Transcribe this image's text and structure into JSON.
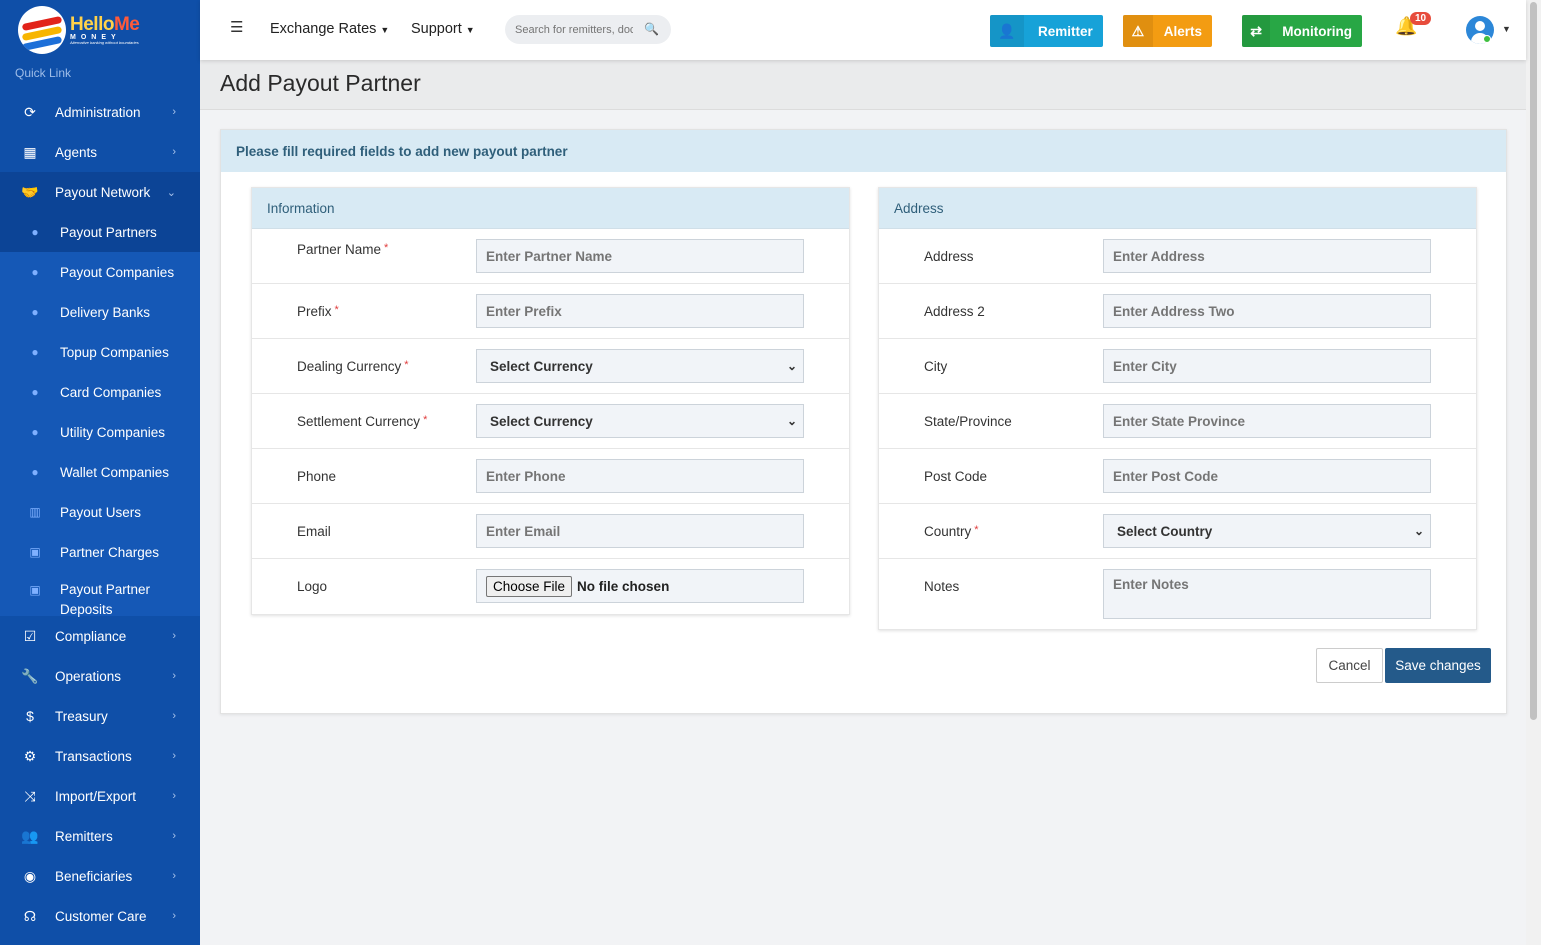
{
  "logo": {
    "brand_a": "Hello",
    "brand_b": "Me",
    "sub": "MONEY",
    "tagline": "Alternative banking without boundaries"
  },
  "sidebar": {
    "quick_link": "Quick Link",
    "items_before": [
      {
        "label": "Administration",
        "icon": "refresh-icon"
      },
      {
        "label": "Agents",
        "icon": "building-icon"
      }
    ],
    "open_item": {
      "label": "Payout Network",
      "icon": "handshake-icon"
    },
    "sub_items": [
      {
        "label": "Payout Partners",
        "icon": "user-icon"
      },
      {
        "label": "Payout Companies",
        "icon": "user-icon"
      },
      {
        "label": "Delivery Banks",
        "icon": "user-icon"
      },
      {
        "label": "Topup Companies",
        "icon": "user-icon"
      },
      {
        "label": "Card Companies",
        "icon": "user-icon"
      },
      {
        "label": "Utility Companies",
        "icon": "user-icon"
      },
      {
        "label": "Wallet Companies",
        "icon": "user-icon"
      },
      {
        "label": "Payout Users",
        "icon": "bank-icon"
      },
      {
        "label": "Partner Charges",
        "icon": "money-icon"
      },
      {
        "label": "Payout Partner Deposits",
        "icon": "money-icon"
      }
    ],
    "items_after": [
      {
        "label": "Compliance",
        "icon": "check-square-icon"
      },
      {
        "label": "Operations",
        "icon": "wrench-icon"
      },
      {
        "label": "Treasury",
        "icon": "dollar-icon"
      },
      {
        "label": "Transactions",
        "icon": "cogs-icon"
      },
      {
        "label": "Import/Export",
        "icon": "shuffle-icon"
      },
      {
        "label": "Remitters",
        "icon": "users-icon"
      },
      {
        "label": "Beneficiaries",
        "icon": "user-circle-icon"
      },
      {
        "label": "Customer Care",
        "icon": "headset-icon"
      }
    ]
  },
  "topbar": {
    "exchange_rates": "Exchange Rates",
    "support": "Support",
    "search_placeholder": "Search for remitters, docs...",
    "remitter": "Remitter",
    "alerts": "Alerts",
    "monitoring": "Monitoring",
    "notification_count": "10",
    "colors": {
      "remitter": "#17a2d8",
      "alerts": "#f39c12",
      "monitoring": "#28a745"
    }
  },
  "page": {
    "title": "Add Payout Partner",
    "instruction": "Please fill required fields to add new payout partner"
  },
  "info_panel": {
    "title": "Information",
    "fields": {
      "partner_name": {
        "label": "Partner Name",
        "placeholder": "Enter Partner Name"
      },
      "prefix": {
        "label": "Prefix",
        "placeholder": "Enter Prefix"
      },
      "dealing_currency": {
        "label": "Dealing Currency",
        "value": "Select Currency"
      },
      "settlement_currency": {
        "label": "Settlement Currency",
        "value": "Select Currency"
      },
      "phone": {
        "label": "Phone",
        "placeholder": "Enter Phone"
      },
      "email": {
        "label": "Email",
        "placeholder": "Enter Email"
      },
      "logo": {
        "label": "Logo",
        "button": "Choose File",
        "status": "No file chosen"
      }
    }
  },
  "address_panel": {
    "title": "Address",
    "fields": {
      "address": {
        "label": "Address",
        "placeholder": "Enter Address"
      },
      "address2": {
        "label": "Address 2",
        "placeholder": "Enter Address Two"
      },
      "city": {
        "label": "City",
        "placeholder": "Enter City"
      },
      "state": {
        "label": "State/Province",
        "placeholder": "Enter State Province"
      },
      "post_code": {
        "label": "Post Code",
        "placeholder": "Enter Post Code"
      },
      "country": {
        "label": "Country",
        "value": "Select Country"
      },
      "notes": {
        "label": "Notes",
        "placeholder": "Enter Notes"
      }
    }
  },
  "actions": {
    "cancel": "Cancel",
    "save": "Save changes"
  }
}
